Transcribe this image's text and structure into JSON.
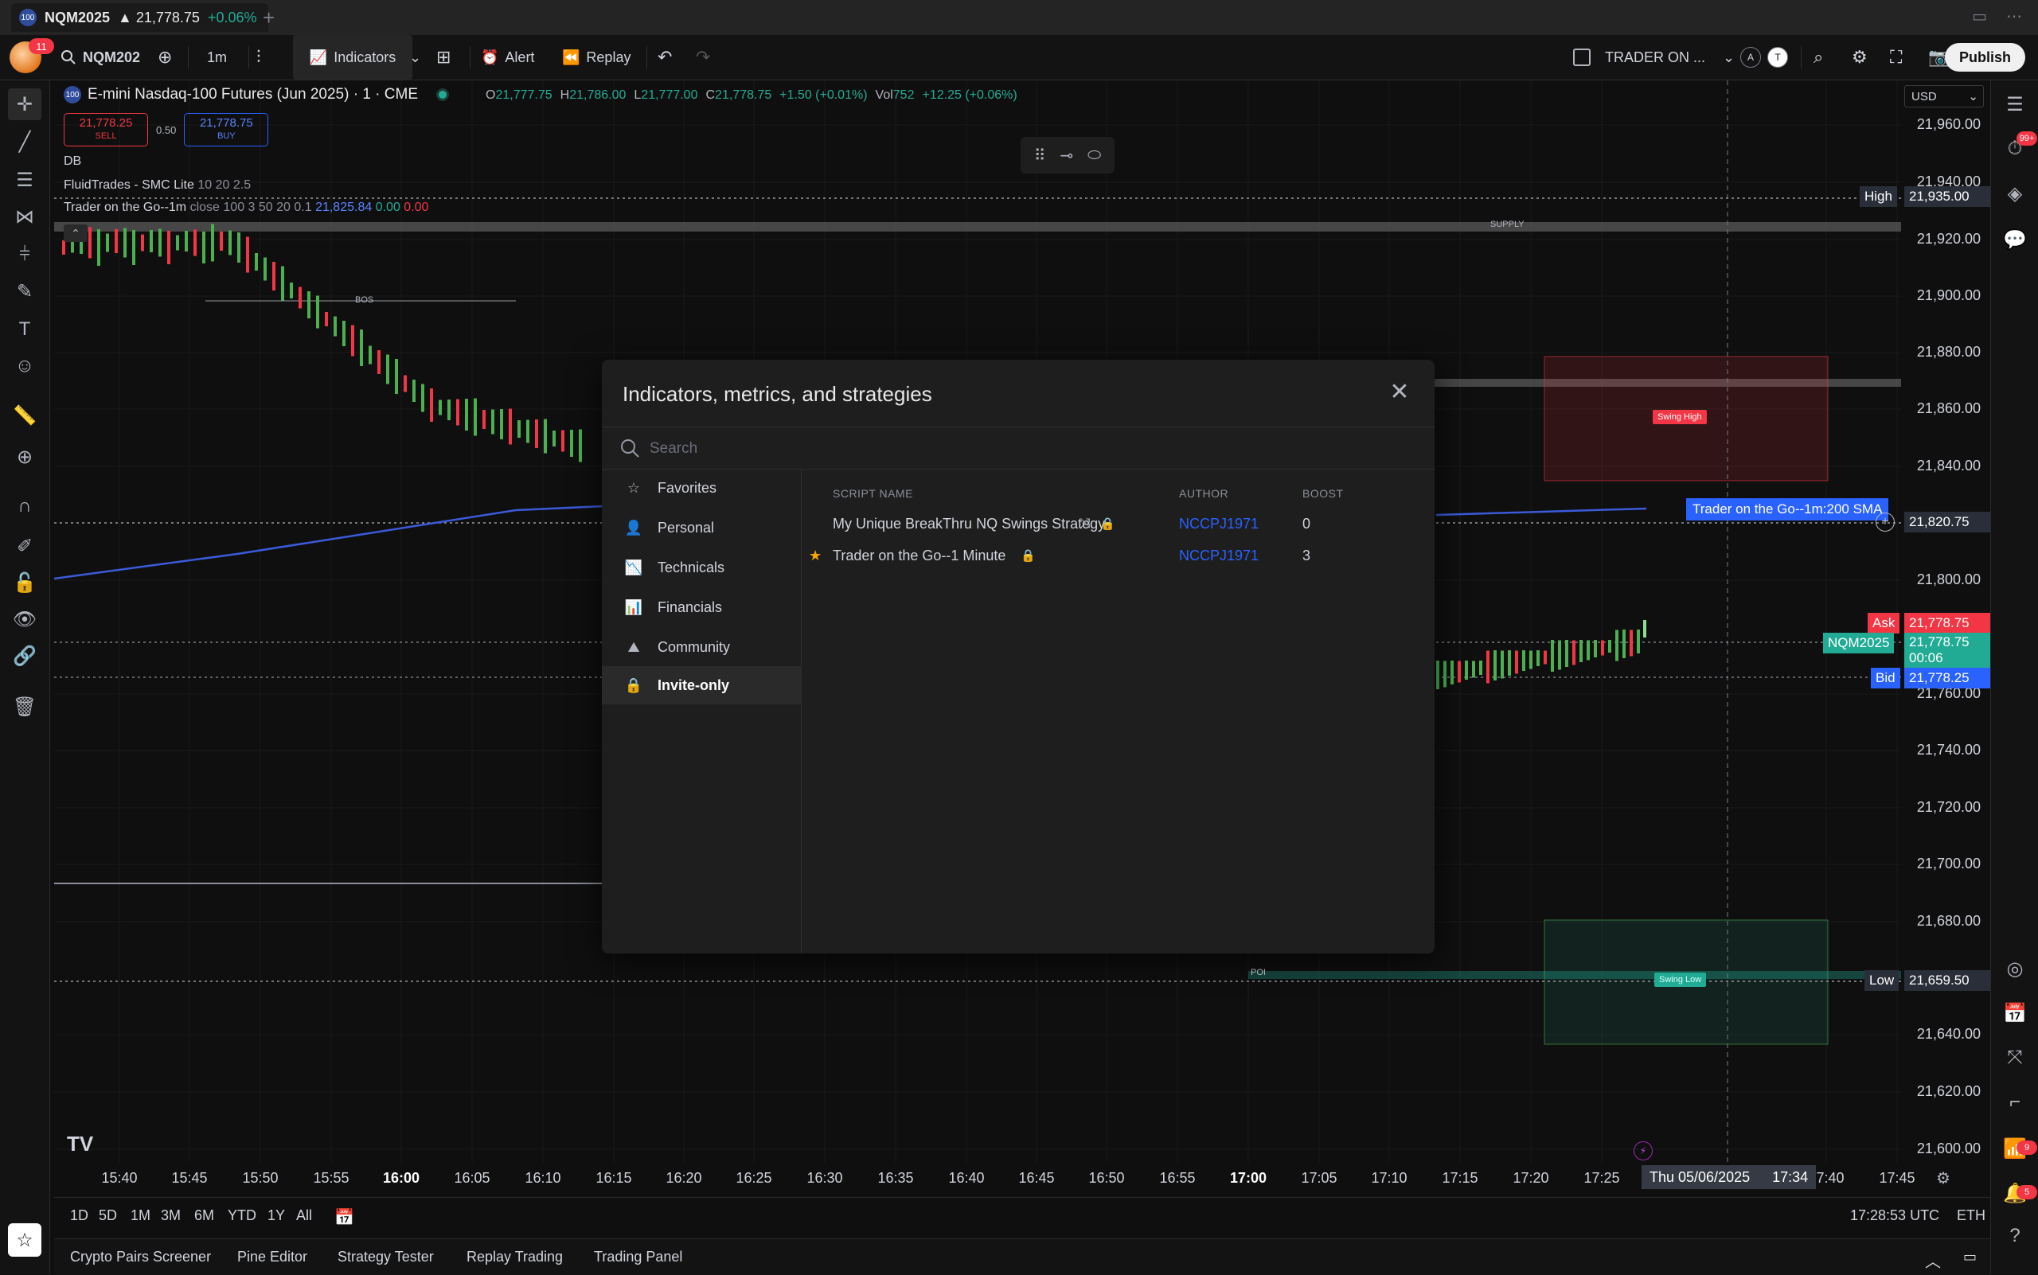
{
  "window_tab": {
    "symbol": "NQM2025",
    "price": "▲ 21,778.75",
    "change": "+0.06%",
    "badge": "100",
    "add": "+"
  },
  "toolbar": {
    "avatar_badge": "11",
    "symbol_search": "NQM202",
    "interval": "1m",
    "indicators_label": "Indicators",
    "alert_label": "Alert",
    "replay_label": "Replay",
    "layout_name": "TRADER ON ...",
    "circle_a": "A",
    "circle_t": "T",
    "publish_label": "Publish"
  },
  "chart": {
    "title": "E-mini Nasdaq-100 Futures (Jun 2025) · 1 · CME",
    "ohlc": {
      "o_k": "O",
      "o": "21,777.75",
      "h_k": "H",
      "h": "21,786.00",
      "l_k": "L",
      "l": "21,777.00",
      "c_k": "C",
      "c": "21,778.75",
      "chg": "+1.50 (+0.01%)",
      "vol_k": "Vol",
      "vol": "752",
      "vol_chg": "+12.25 (+0.06%)"
    },
    "sell_price": "21,778.25",
    "sell_label": "SELL",
    "spread": "0.50",
    "buy_price": "21,778.75",
    "buy_label": "BUY",
    "indicators": [
      {
        "name": "DB",
        "params": ""
      },
      {
        "name": "FluidTrades - SMC Lite",
        "params": "10 20 2.5"
      },
      {
        "name": "Trader on the Go--1m",
        "params": "close 100 3 50 20 0.1",
        "v1": "21,825.84",
        "v2": "0.00",
        "v3": "0.00"
      }
    ],
    "labels": {
      "supply": "SUPPLY",
      "bos": "BOS",
      "swing_high": "Swing High",
      "swing_low": "Swing Low",
      "poi": "POI",
      "sma_tag": "Trader on the Go--1m:200 SMA"
    },
    "currency": "USD"
  },
  "price_axis": {
    "ticks": [
      "21,960.00",
      "21,940.00",
      "21,920.00",
      "21,900.00",
      "21,880.00",
      "21,860.00",
      "21,840.00",
      "21,800.00",
      "21,760.00",
      "21,740.00",
      "21,720.00",
      "21,700.00",
      "21,680.00",
      "21,640.00",
      "21,620.00",
      "21,600.00"
    ],
    "high_label": "High",
    "high_value": "21,935.00",
    "sma_value": "21,820.75",
    "ask_label": "Ask",
    "ask_value": "21,778.75",
    "last_symbol": "NQM2025",
    "last_value": "21,778.75",
    "countdown": "00:06",
    "bid_label": "Bid",
    "bid_value": "21,778.25",
    "low_label": "Low",
    "low_value": "21,659.50"
  },
  "time_axis": {
    "ticks": [
      "15:40",
      "15:45",
      "15:50",
      "15:55",
      "16:00",
      "16:05",
      "16:10",
      "16:15",
      "16:20",
      "16:25",
      "16:30",
      "16:35",
      "16:40",
      "16:45",
      "16:50",
      "16:55",
      "17:00",
      "17:05",
      "17:10",
      "17:15",
      "17:20",
      "17:25",
      "17:40",
      "17:45"
    ],
    "crosshair_date": "Thu 05/06/2025",
    "crosshair_time": "17:34"
  },
  "range_bar": {
    "ranges": [
      "1D",
      "5D",
      "1M",
      "3M",
      "6M",
      "YTD",
      "1Y",
      "All"
    ],
    "clock": "17:28:53 UTC",
    "session": "ETH"
  },
  "bottom_tabs": [
    "Crypto Pairs Screener",
    "Pine Editor",
    "Strategy Tester",
    "Replay Trading",
    "Trading Panel"
  ],
  "right_badges": {
    "top": "99+",
    "mid": "9",
    "bottom": "5"
  },
  "modal": {
    "title": "Indicators, metrics, and strategies",
    "search_placeholder": "Search",
    "nav": [
      "Favorites",
      "Personal",
      "Technicals",
      "Financials",
      "Community",
      "Invite-only"
    ],
    "columns": {
      "name": "SCRIPT NAME",
      "author": "AUTHOR",
      "boost": "BOOST"
    },
    "rows": [
      {
        "name": "My Unique BreakThru NQ Swings Strategy",
        "author": "NCCPJ1971",
        "boost": "0",
        "favorite": false
      },
      {
        "name": "Trader on the Go--1 Minute",
        "author": "NCCPJ1971",
        "boost": "3",
        "favorite": true
      }
    ]
  },
  "colors": {
    "up": "#22ab94",
    "down": "#f23645",
    "accent": "#2962ff",
    "sma": "#3b5bdb"
  }
}
